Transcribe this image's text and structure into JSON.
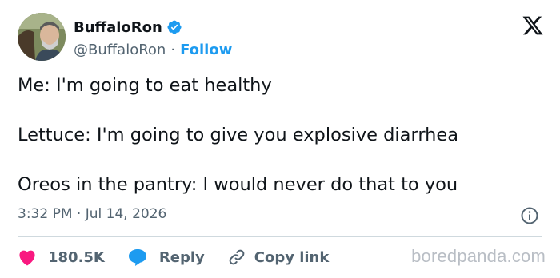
{
  "author": {
    "display_name": "BuffaloRon",
    "handle": "@BuffaloRon",
    "separator": "·",
    "follow_label": "Follow",
    "verified_color": "#1d9bf0"
  },
  "tweet": {
    "lines": [
      "Me: I'm going to eat healthy",
      "Lettuce: I'm going to give you explosive diarrhea",
      "Oreos in the pantry: I would never do that to you"
    ],
    "time": "3:32 PM",
    "date_separator": "·",
    "date": "Jul 14, 2026"
  },
  "actions": {
    "likes": "180.5K",
    "like_color": "#f91880",
    "reply_label": "Reply",
    "reply_color": "#1d9bf0",
    "copy_label": "Copy link"
  },
  "icons": [
    "verified-badge-icon",
    "x-logo-icon",
    "info-icon",
    "heart-icon",
    "reply-bubble-icon",
    "link-icon"
  ],
  "watermark": "boredpanda.com"
}
